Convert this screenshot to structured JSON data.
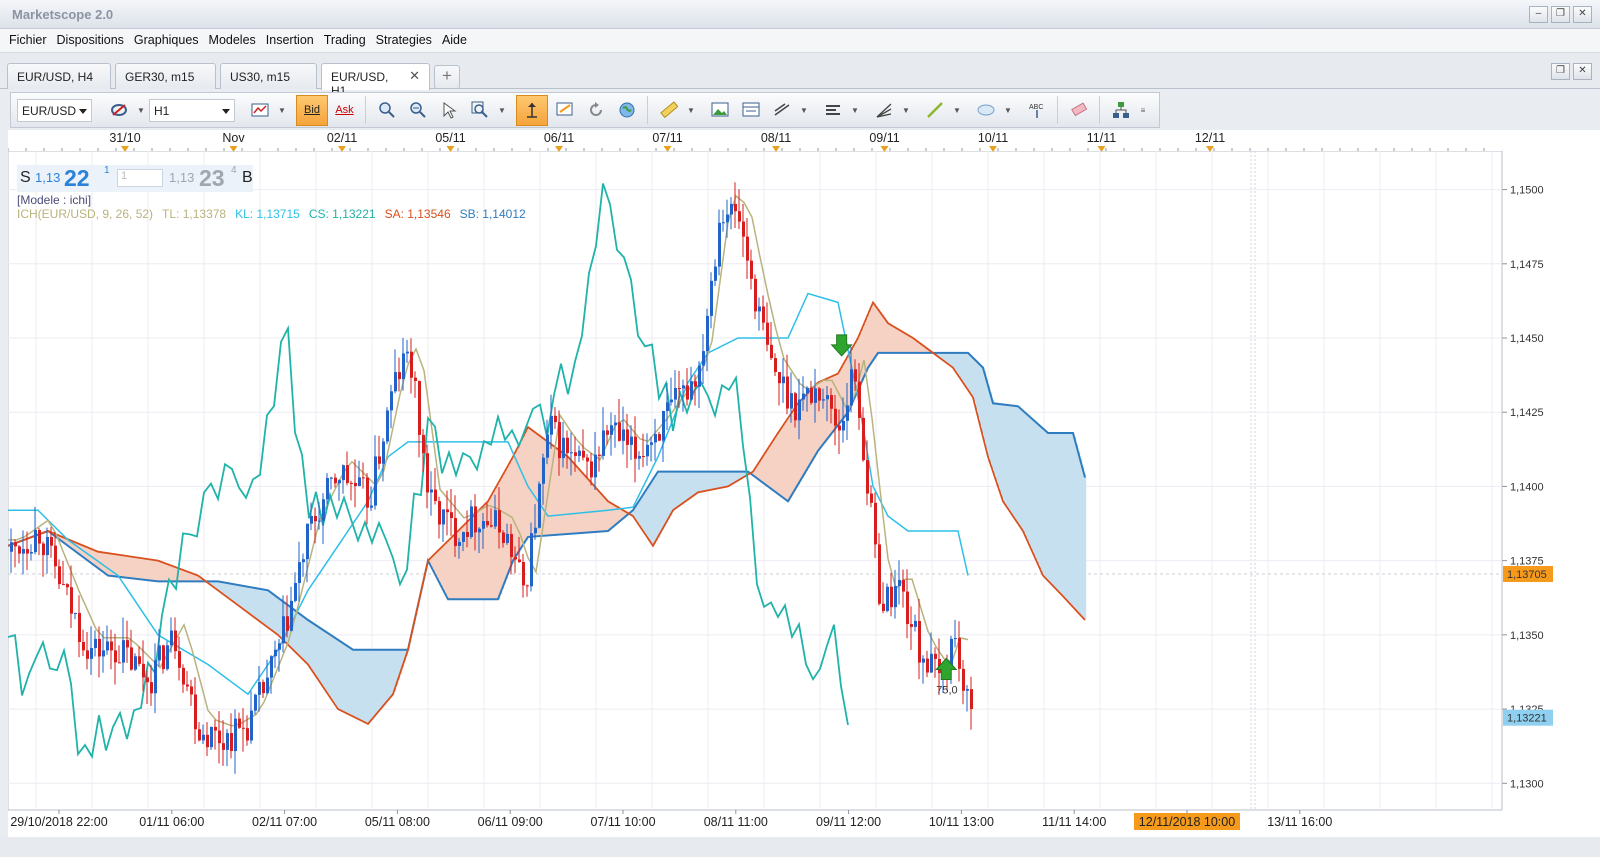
{
  "window": {
    "title": "Marketscope 2.0",
    "buttons": [
      "–",
      "❐",
      "✕"
    ],
    "tabbar_buttons": [
      "❐",
      "✕"
    ]
  },
  "menu": [
    "Fichier",
    "Dispositions",
    "Graphiques",
    "Modeles",
    "Insertion",
    "Trading",
    "Strategies",
    "Aide"
  ],
  "tabs": [
    {
      "label": "EUR/USD, H4",
      "active": false
    },
    {
      "label": "GER30, m15",
      "active": false
    },
    {
      "label": "US30, m15",
      "active": false
    },
    {
      "label": "EUR/USD, H1",
      "active": true,
      "close": "✕"
    }
  ],
  "tab_add": "+",
  "toolbar": {
    "symbol": "EUR/USD",
    "timeframe": "H1",
    "bid_label": "Bid",
    "ask_label": "Ask",
    "icons": [
      "indicator-icon",
      "link-icon",
      "chart-type-icon",
      "zoom-in-icon",
      "zoom-out-icon",
      "cursor-icon",
      "zoom-icon",
      "autoscroll-icon",
      "chart-properties-icon",
      "refresh-icon",
      "globe-icon",
      "ruler-icon",
      "picture-icon",
      "template-icon",
      "trendline-icon",
      "levels-icon",
      "fan-icon",
      "line-icon",
      "ellipse-icon",
      "text-icon",
      "eraser-icon",
      "hierarchy-icon",
      "more-icon"
    ]
  },
  "price_panel": {
    "sell_label": "S",
    "sell_quote": "1,13",
    "sell_pips": "22",
    "sell_fraction": "1",
    "amount": "1",
    "buy_quote": "1,13",
    "buy_pips": "23",
    "buy_fraction": "4",
    "buy_label": "B"
  },
  "indicator": {
    "model_label": "[Modele : ichi]",
    "name": "ICH(EUR/USD, 9, 26, 52)",
    "tl": "TL: 1,13378",
    "kl": "KL: 1,13715",
    "cs": "CS: 1,13221",
    "sa": "SA: 1,13546",
    "sb": "SB: 1,14012"
  },
  "colors": {
    "tl": "#b9b37d",
    "kl": "#2dbfe8",
    "cs": "#1fb3aa",
    "sa": "#d9501e",
    "sb": "#2f7cc0",
    "bull_candle": "#2163c7",
    "bear_candle": "#d61e1e",
    "cloud_bull": "#c7e0ef",
    "cloud_bear": "#f5d2c3",
    "price_tag": "#f59a1b",
    "cs_tag": "#8fd0f0"
  },
  "chart_data": {
    "type": "candlestick",
    "symbol": "EUR/USD",
    "timeframe": "H1",
    "top_axis_ticks": [
      "31/10",
      "Nov",
      "02/11",
      "05/11",
      "06/11",
      "07/11",
      "08/11",
      "09/11",
      "10/11",
      "11/11",
      "12/11"
    ],
    "bottom_axis_ticks": [
      "29/10/2018 22:00",
      "01/11 06:00",
      "02/11 07:00",
      "05/11 08:00",
      "06/11 09:00",
      "07/11 10:00",
      "08/11 11:00",
      "09/11 12:00",
      "10/11 13:00",
      "11/11 14:00",
      "12/11/2018 10:00",
      "13/11 16:00"
    ],
    "highlighted_time": "12/11/2018 10:00",
    "y_ticks": [
      "1,1500",
      "1,1475",
      "1,1450",
      "1,1425",
      "1,1400",
      "1,1375",
      "1,1350",
      "1,1325",
      "1,1300"
    ],
    "ylim": [
      1.1291,
      1.1513
    ],
    "current_price_tag": "1,13705",
    "current_price": 1.13705,
    "cs_price_tag": "1,13221",
    "cs_price": 1.13221,
    "trade_marker_label": "75,0",
    "markers": [
      {
        "type": "sell-arrow",
        "price": 1.1447,
        "x_fraction": 0.558
      },
      {
        "type": "buy-arrow",
        "price": 1.1339,
        "x_fraction": 0.628
      }
    ]
  }
}
